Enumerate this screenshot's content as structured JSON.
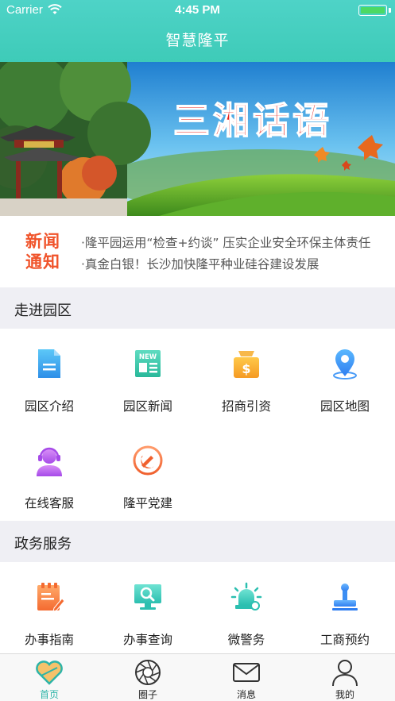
{
  "status_bar": {
    "carrier": "Carrier",
    "time": "4:45 PM"
  },
  "nav": {
    "title": "智慧隆平"
  },
  "banner": {
    "caption": "三湘话语",
    "page_count": 3,
    "active_page": 2
  },
  "news": {
    "logo_line1": "新闻",
    "logo_line2": "通知",
    "items": [
      "·隆平园运用“检查+约谈” 压实企业安全环保主体责任",
      "·真金白银！长沙加快隆平种业硅谷建设发展"
    ]
  },
  "section_park": {
    "title": "走进园区",
    "items": [
      {
        "label": "园区介绍",
        "icon": "document-icon"
      },
      {
        "label": "园区新闻",
        "icon": "news-icon"
      },
      {
        "label": "招商引资",
        "icon": "money-bag-icon"
      },
      {
        "label": "园区地图",
        "icon": "map-pin-icon"
      },
      {
        "label": "在线客服",
        "icon": "headset-icon"
      },
      {
        "label": "隆平党建",
        "icon": "party-emblem-icon"
      }
    ]
  },
  "section_gov": {
    "title": "政务服务",
    "items": [
      {
        "label": "办事指南",
        "icon": "guide-icon"
      },
      {
        "label": "办事查询",
        "icon": "search-monitor-icon"
      },
      {
        "label": "微警务",
        "icon": "police-light-icon"
      },
      {
        "label": "工商预约",
        "icon": "stamp-icon"
      }
    ]
  },
  "tabbar": {
    "tabs": [
      {
        "label": "首页",
        "icon": "home-heart-icon",
        "active": true
      },
      {
        "label": "圈子",
        "icon": "aperture-icon",
        "active": false
      },
      {
        "label": "消息",
        "icon": "envelope-icon",
        "active": false
      },
      {
        "label": "我的",
        "icon": "person-icon",
        "active": false
      }
    ]
  },
  "colors": {
    "header": "#3ecbb8",
    "accent": "#2db4a8",
    "news_logo": "#f0532a",
    "section_bg": "#efeff4"
  }
}
